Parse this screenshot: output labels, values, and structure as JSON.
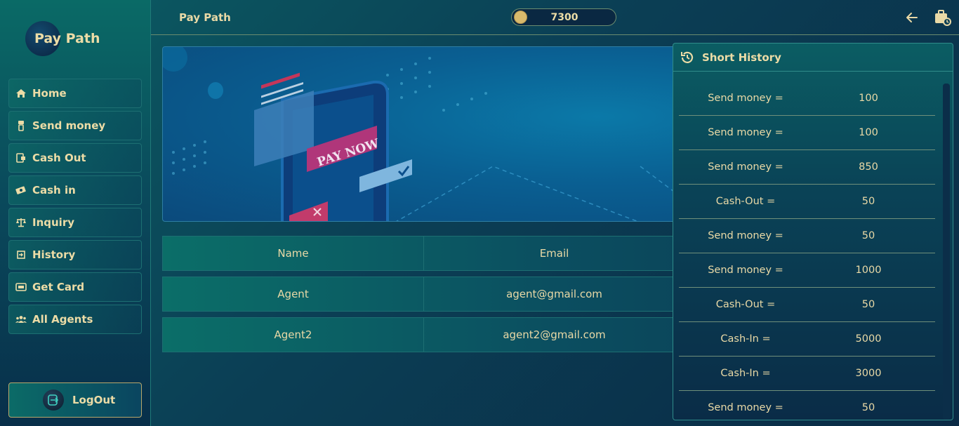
{
  "sidebar": {
    "logo_text": "Pay Path",
    "items": [
      {
        "label": "Home",
        "icon": "home-icon"
      },
      {
        "label": "Send money",
        "icon": "send-money-icon"
      },
      {
        "label": "Cash Out",
        "icon": "cash-out-icon"
      },
      {
        "label": "Cash in",
        "icon": "cash-in-icon"
      },
      {
        "label": "Inquiry",
        "icon": "scale-icon"
      },
      {
        "label": "History",
        "icon": "history-icon"
      },
      {
        "label": "Get Card",
        "icon": "card-icon"
      },
      {
        "label": "All Agents",
        "icon": "users-icon"
      }
    ],
    "logout_label": "LogOut"
  },
  "header": {
    "title": "Pay Path",
    "balance": "7300"
  },
  "banner": {
    "pay_now_text": "PAY NOW"
  },
  "table": {
    "headers": [
      "Name",
      "Email"
    ],
    "rows": [
      [
        "Agent",
        "agent@gmail.com"
      ],
      [
        "Agent2",
        "agent2@gmail.com"
      ]
    ]
  },
  "history": {
    "title": "Short History",
    "rows": [
      {
        "label": "Send money =",
        "amount": "100"
      },
      {
        "label": "Send money =",
        "amount": "100"
      },
      {
        "label": "Send money =",
        "amount": "850"
      },
      {
        "label": "Cash-Out =",
        "amount": "50"
      },
      {
        "label": "Send money =",
        "amount": "50"
      },
      {
        "label": "Send money =",
        "amount": "1000"
      },
      {
        "label": "Cash-Out =",
        "amount": "50"
      },
      {
        "label": "Cash-In =",
        "amount": "5000"
      },
      {
        "label": "Cash-In =",
        "amount": "3000"
      },
      {
        "label": "Send money =",
        "amount": "50"
      }
    ]
  },
  "colors": {
    "accent_text": "#ecdca6",
    "coin": "#d8b96c",
    "border_teal": "#1d6f72"
  }
}
